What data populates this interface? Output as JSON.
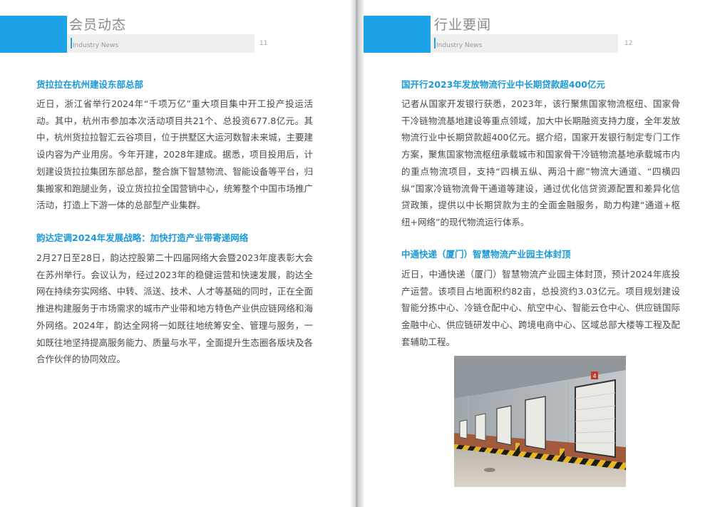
{
  "left_page": {
    "section_title": "会员动态",
    "section_subtitle": "Industry News",
    "page_number": "11",
    "articles": [
      {
        "title": "货拉拉在杭州建设东部总部",
        "body": "近日，浙江省举行2024年“千项万亿”重大项目集中开工投产投运活动。其中，杭州市参加本次活动项目共21个、总投资677.8亿元。其中，杭州货拉拉智汇云谷项目，位于拱墅区大运河数智未来城，主要建设内容为产业用房。今年开建，2028年建成。据悉，项目投用后，计划建设货拉拉集团东部总部，整合旗下智慧物流、智能设备等平台，归集搬家和跑腿业务，设立货拉拉全国营销中心，统筹整个中国市场推广活动，打造上下游一体的总部型产业集群。"
      },
      {
        "title": "韵达定调2024年发展战略：加快打造产业带寄递网络",
        "body": "2月27日至28日，韵达控股第二十四届网络大会暨2023年度表彰大会在苏州举行。会议认为，经过2023年的稳健运营和快速发展，韵达全网在持续夯实网络、中转、派送、技术、人才等基础的同时，正在全面推进构建服务于市场需求的城市产业带和地方特色产业供应链网络和海外网络。2024年，韵达全网将一如既往地统筹安全、管理与服务，一如既往地坚持提高服务能力、质量与水平，全面提升生态圈各版块及各合作伙伴的协同效应。"
      }
    ]
  },
  "right_page": {
    "section_title": "行业要闻",
    "section_subtitle": "Industry News",
    "page_number": "12",
    "articles": [
      {
        "title": "国开行2023年发放物流行业中长期贷款超400亿元",
        "body": "记者从国家开发银行获悉，2023年，该行聚焦国家物流枢纽、国家骨干冷链物流基地建设等重点领域，加大中长期融资支持力度，全年发放物流行业中长期贷款超400亿元。据介绍，国家开发银行制定专门工作方案，聚焦国家物流枢纽承载城市和国家骨干冷链物流基地承载城市内的重点物流项目，支持“四横五纵、两沿十廊”物流大通道、“四横四纵”国家冷链物流骨干通道等建设，通过优化信贷资源配置和差异化信贷政策，提供以中长期贷款为主的全面金融服务，助力构建“通道+枢纽+网络”的现代物流运行体系。"
      },
      {
        "title": "中通快递（厦门）智慧物流产业园主体封顶",
        "body": "近日，中通快递（厦门）智慧物流产业园主体封顶，预计2024年底投产运营。该项目占地面积约82亩，总投资约3.03亿元。项目规划建设智能分拣中心、冷链仓配中心、航空中心、智能云仓中心、供应链国际金融中心、供应链研发中心、跨境电商中心、区域总部大楼等工程及配套辅助工程。"
      }
    ],
    "photo_dock_number": "4"
  },
  "colors": {
    "accent_blue": "#1fa3e8",
    "title_blue": "#1c9ad8",
    "body_text": "#4a4a4a",
    "header_grey": "#8a8a8a"
  }
}
